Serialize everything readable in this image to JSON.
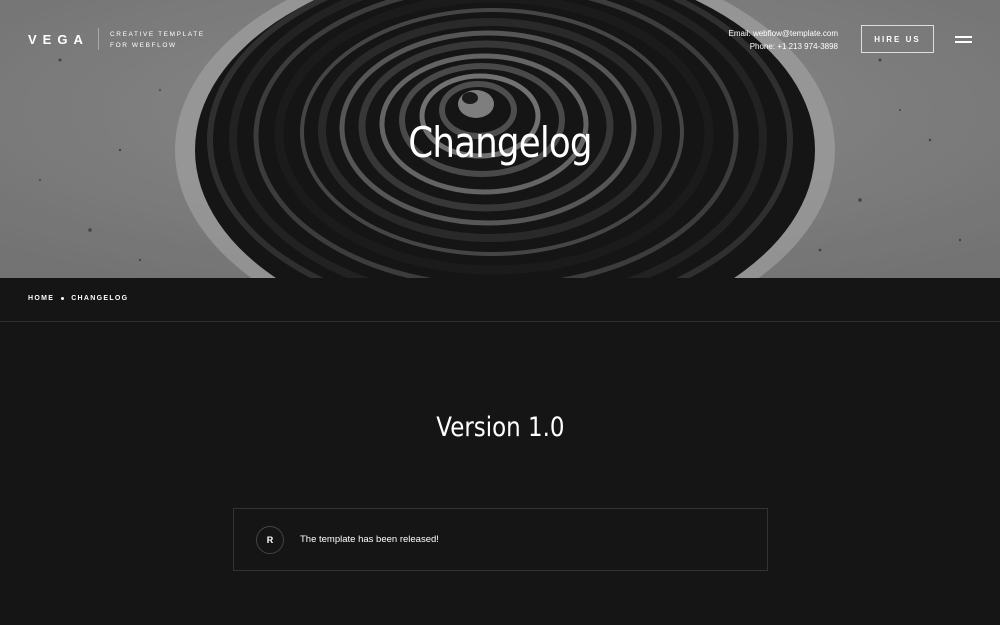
{
  "header": {
    "logo": "VEGA",
    "tagline_line1": "CREATIVE TEMPLATE",
    "tagline_line2": "FOR WEBFLOW",
    "contact_email": "Email: webflow@template.com",
    "contact_phone": "Phone: +1 213 974-3898",
    "hire_button": "HIRE US",
    "menu_icon": "hamburger-menu-icon"
  },
  "hero": {
    "title": "Changelog"
  },
  "breadcrumb": {
    "items": [
      "HOME",
      "CHANGELOG"
    ]
  },
  "main": {
    "version_title": "Version 1.0",
    "entries": [
      {
        "badge": "R",
        "text": "The template has been released!"
      }
    ]
  },
  "colors": {
    "background": "#151515",
    "text": "#ffffff",
    "border": "#333333"
  }
}
